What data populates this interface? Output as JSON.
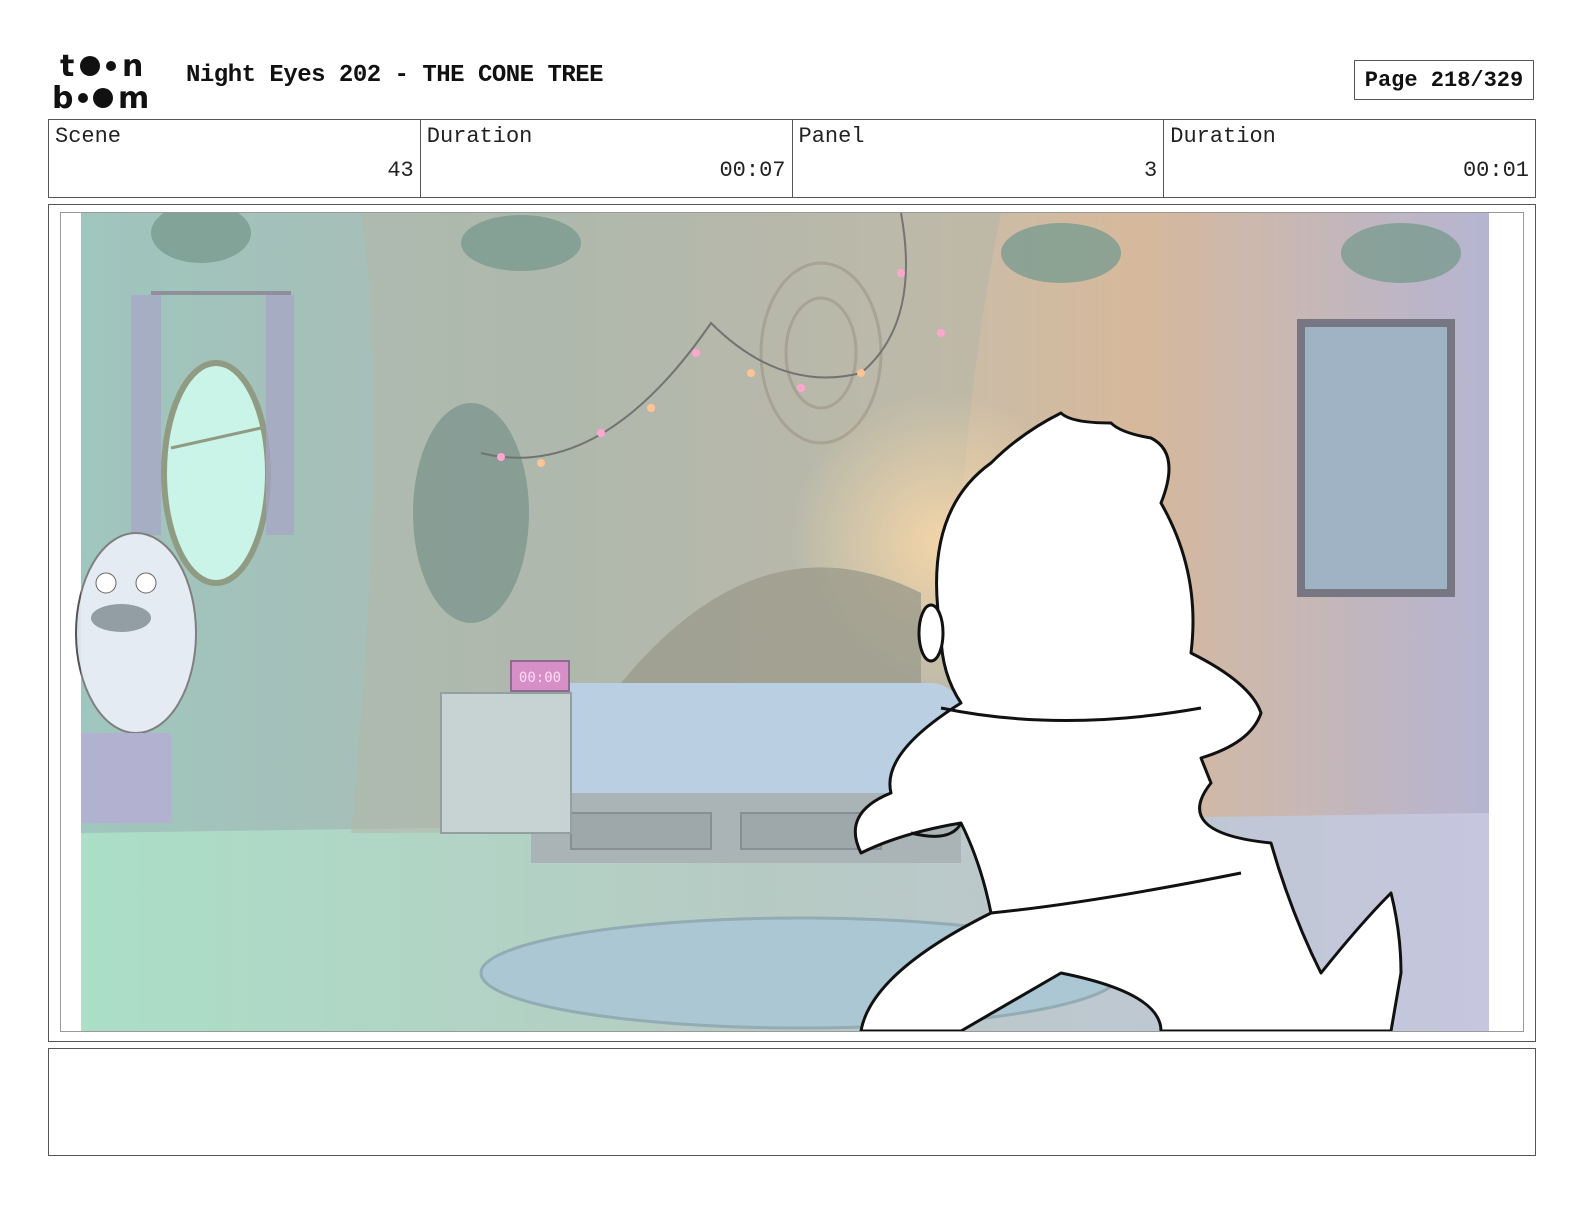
{
  "header": {
    "logo_text": "toon boom",
    "title": "Night Eyes 202 - THE CONE TREE",
    "page_label": "Page 218/329"
  },
  "info": {
    "scene_label": "Scene",
    "scene_value": "43",
    "scene_duration_label": "Duration",
    "scene_duration_value": "00:07",
    "panel_label": "Panel",
    "panel_value": "3",
    "panel_duration_label": "Duration",
    "panel_duration_value": "00:01"
  },
  "panel": {
    "clock_text": "00:00",
    "description": ""
  },
  "notes": {
    "text": ""
  }
}
